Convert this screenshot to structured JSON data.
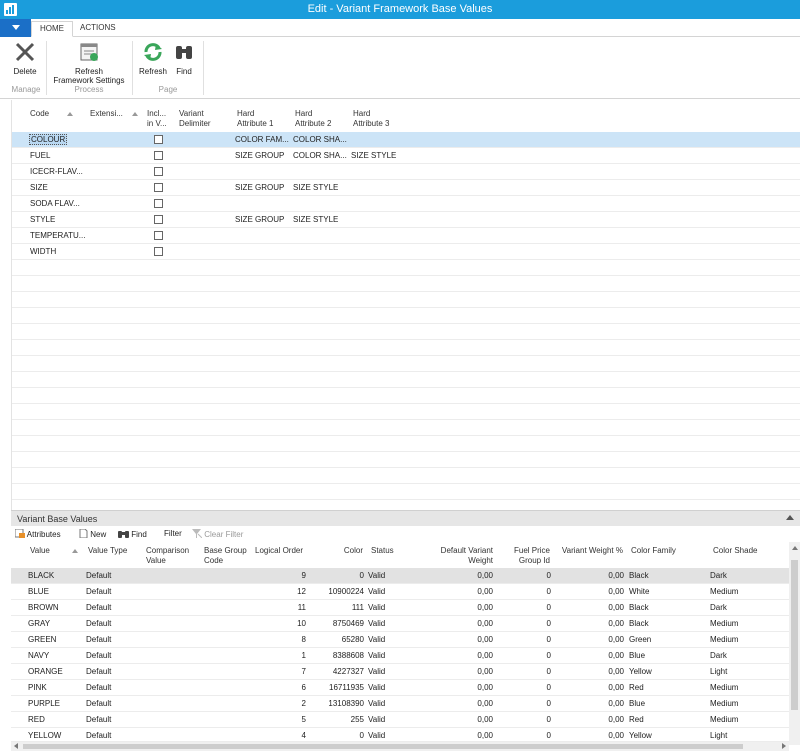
{
  "window": {
    "title": "Edit - Variant Framework Base Values"
  },
  "ribbon": {
    "tabs": {
      "home": "HOME",
      "actions": "ACTIONS"
    },
    "manage": {
      "label": "Manage",
      "delete": "Delete"
    },
    "process": {
      "label": "Process",
      "refresh_fw_line1": "Refresh",
      "refresh_fw_line2": "Framework Settings"
    },
    "page": {
      "label": "Page",
      "refresh": "Refresh",
      "find": "Find"
    }
  },
  "upper": {
    "headers": {
      "code": "Code",
      "extension": "Extensi...",
      "include_l1": "Incl...",
      "include_l2": "in V...",
      "delim_l1": "Variant",
      "delim_l2": "Delimiter",
      "ha1_l1": "Hard",
      "ha1_l2": "Attribute 1",
      "ha2_l1": "Hard",
      "ha2_l2": "Attribute 2",
      "ha3_l1": "Hard",
      "ha3_l2": "Attribute 3"
    },
    "rows": [
      {
        "code": "COLOUR",
        "ha1": "COLOR FAM...",
        "ha2": "COLOR SHA...",
        "ha3": ""
      },
      {
        "code": "FUEL",
        "ha1": "SIZE GROUP",
        "ha2": "COLOR SHA...",
        "ha3": "SIZE STYLE"
      },
      {
        "code": "ICECR-FLAV...",
        "ha1": "",
        "ha2": "",
        "ha3": ""
      },
      {
        "code": "SIZE",
        "ha1": "SIZE GROUP",
        "ha2": "SIZE STYLE",
        "ha3": ""
      },
      {
        "code": "SODA FLAV...",
        "ha1": "",
        "ha2": "",
        "ha3": ""
      },
      {
        "code": "STYLE",
        "ha1": "SIZE GROUP",
        "ha2": "SIZE STYLE",
        "ha3": ""
      },
      {
        "code": "TEMPERATU...",
        "ha1": "",
        "ha2": "",
        "ha3": ""
      },
      {
        "code": "WIDTH",
        "ha1": "",
        "ha2": "",
        "ha3": ""
      }
    ]
  },
  "lower": {
    "title": "Variant Base Values",
    "toolbar": {
      "attributes": "Attributes",
      "new": "New",
      "find": "Find",
      "filter": "Filter",
      "clear_filter": "Clear Filter"
    },
    "headers": {
      "value": "Value",
      "value_type": "Value Type",
      "comparison_l1": "Comparison",
      "comparison_l2": "Value",
      "base_group_l1": "Base Group",
      "base_group_l2": "Code",
      "logical_order": "Logical Order",
      "color": "Color",
      "status": "Status",
      "dvw_l1": "Default Variant",
      "dvw_l2": "Weight",
      "fpg_l1": "Fuel Price",
      "fpg_l2": "Group Id",
      "vw_pct": "Variant Weight %",
      "color_family": "Color Family",
      "color_shade": "Color Shade"
    },
    "rows": [
      {
        "value": "BLACK",
        "type": "Default",
        "order": "9",
        "color": "0",
        "status": "Valid",
        "dvw": "0,00",
        "fpg": "0",
        "vwp": "0,00",
        "family": "Black",
        "shade": "Dark"
      },
      {
        "value": "BLUE",
        "type": "Default",
        "order": "12",
        "color": "10900224",
        "status": "Valid",
        "dvw": "0,00",
        "fpg": "0",
        "vwp": "0,00",
        "family": "White",
        "shade": "Medium"
      },
      {
        "value": "BROWN",
        "type": "Default",
        "order": "11",
        "color": "111",
        "status": "Valid",
        "dvw": "0,00",
        "fpg": "0",
        "vwp": "0,00",
        "family": "Black",
        "shade": "Dark"
      },
      {
        "value": "GRAY",
        "type": "Default",
        "order": "10",
        "color": "8750469",
        "status": "Valid",
        "dvw": "0,00",
        "fpg": "0",
        "vwp": "0,00",
        "family": "Black",
        "shade": "Medium"
      },
      {
        "value": "GREEN",
        "type": "Default",
        "order": "8",
        "color": "65280",
        "status": "Valid",
        "dvw": "0,00",
        "fpg": "0",
        "vwp": "0,00",
        "family": "Green",
        "shade": "Medium"
      },
      {
        "value": "NAVY",
        "type": "Default",
        "order": "1",
        "color": "8388608",
        "status": "Valid",
        "dvw": "0,00",
        "fpg": "0",
        "vwp": "0,00",
        "family": "Blue",
        "shade": "Dark"
      },
      {
        "value": "ORANGE",
        "type": "Default",
        "order": "7",
        "color": "4227327",
        "status": "Valid",
        "dvw": "0,00",
        "fpg": "0",
        "vwp": "0,00",
        "family": "Yellow",
        "shade": "Light"
      },
      {
        "value": "PINK",
        "type": "Default",
        "order": "6",
        "color": "16711935",
        "status": "Valid",
        "dvw": "0,00",
        "fpg": "0",
        "vwp": "0,00",
        "family": "Red",
        "shade": "Medium"
      },
      {
        "value": "PURPLE",
        "type": "Default",
        "order": "2",
        "color": "13108390",
        "status": "Valid",
        "dvw": "0,00",
        "fpg": "0",
        "vwp": "0,00",
        "family": "Blue",
        "shade": "Medium"
      },
      {
        "value": "RED",
        "type": "Default",
        "order": "5",
        "color": "255",
        "status": "Valid",
        "dvw": "0,00",
        "fpg": "0",
        "vwp": "0,00",
        "family": "Red",
        "shade": "Medium"
      },
      {
        "value": "YELLOW",
        "type": "Default",
        "order": "4",
        "color": "0",
        "status": "Valid",
        "dvw": "0,00",
        "fpg": "0",
        "vwp": "0,00",
        "family": "Yellow",
        "shade": "Light"
      }
    ]
  },
  "colors": {
    "titlebar": "#1b9ddc",
    "file_button": "#1b6fc7",
    "selected_row": "#cce4f7",
    "refresh_icon": "#3aa65a"
  }
}
